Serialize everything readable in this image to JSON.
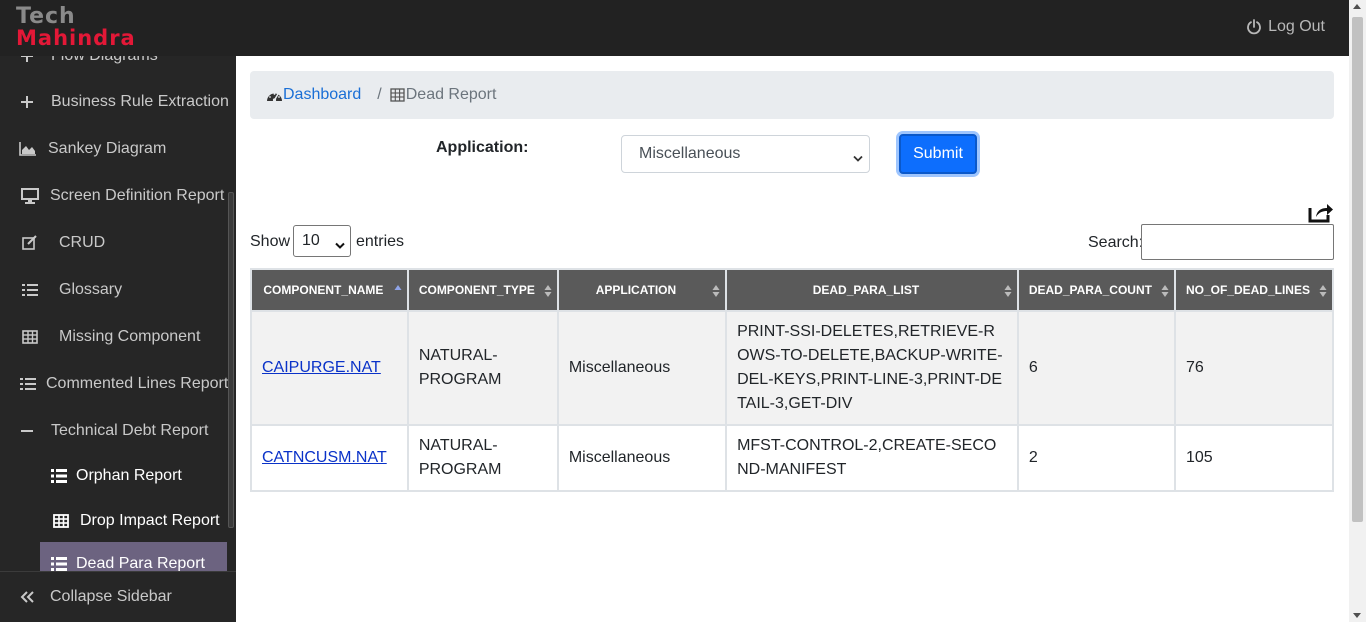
{
  "header": {
    "logo_line1": "Tech",
    "logo_line2": "Mahindra",
    "logout_label": "Log Out",
    "colors": {
      "bar": "#222222",
      "logo_red": "#e31837",
      "logo_gray": "#8a8a8a"
    }
  },
  "sidebar": {
    "items": [
      {
        "label": "Flow Diagrams",
        "icon": "plus-icon"
      },
      {
        "label": "Business Rule Extraction",
        "icon": "plus-icon"
      },
      {
        "label": "Sankey Diagram",
        "icon": "area-chart-icon"
      },
      {
        "label": "Screen Definition Report",
        "icon": "desktop-icon"
      },
      {
        "label": "CRUD",
        "icon": "edit-icon"
      },
      {
        "label": "Glossary",
        "icon": "list-icon"
      },
      {
        "label": "Missing Component",
        "icon": "table-icon"
      },
      {
        "label": "Commented Lines Report",
        "icon": "list-icon"
      },
      {
        "label": "Technical Debt Report",
        "icon": "minus-icon"
      }
    ],
    "subitems": [
      {
        "label": "Orphan Report",
        "icon": "list-icon"
      },
      {
        "label": "Drop Impact Report",
        "icon": "table-icon"
      },
      {
        "label": "Dead Para Report",
        "icon": "list-icon",
        "active": true
      }
    ],
    "collapse_label": "Collapse Sidebar"
  },
  "breadcrumb": {
    "home": "Dashboard",
    "separator": "/",
    "current": "Dead Report"
  },
  "form": {
    "app_label": "Application:",
    "app_value": "Miscellaneous",
    "submit_label": "Submit"
  },
  "table_controls": {
    "show_label": "Show",
    "entries_value": "10",
    "entries_label": "entries",
    "search_label": "Search:",
    "search_value": ""
  },
  "table": {
    "columns": [
      "COMPONENT_NAME",
      "COMPONENT_TYPE",
      "APPLICATION",
      "DEAD_PARA_LIST",
      "DEAD_PARA_COUNT",
      "NO_OF_DEAD_LINES"
    ],
    "rows": [
      {
        "component_name": "CAIPURGE.NAT",
        "component_type": "NATURAL-PROGRAM",
        "application": "Miscellaneous",
        "dead_para_list": "PRINT-SSI-DELETES,RETRIEVE-ROWS-TO-DELETE,BACKUP-WRITE-DEL-KEYS,PRINT-LINE-3,PRINT-DETAIL-3,GET-DIV",
        "dead_para_count": "6",
        "no_of_dead_lines": "76"
      },
      {
        "component_name": "CATNCUSM.NAT",
        "component_type": "NATURAL-PROGRAM",
        "application": "Miscellaneous",
        "dead_para_list": "MFST-CONTROL-2,CREATE-SECOND-MANIFEST",
        "dead_para_count": "2",
        "no_of_dead_lines": "105"
      }
    ]
  }
}
